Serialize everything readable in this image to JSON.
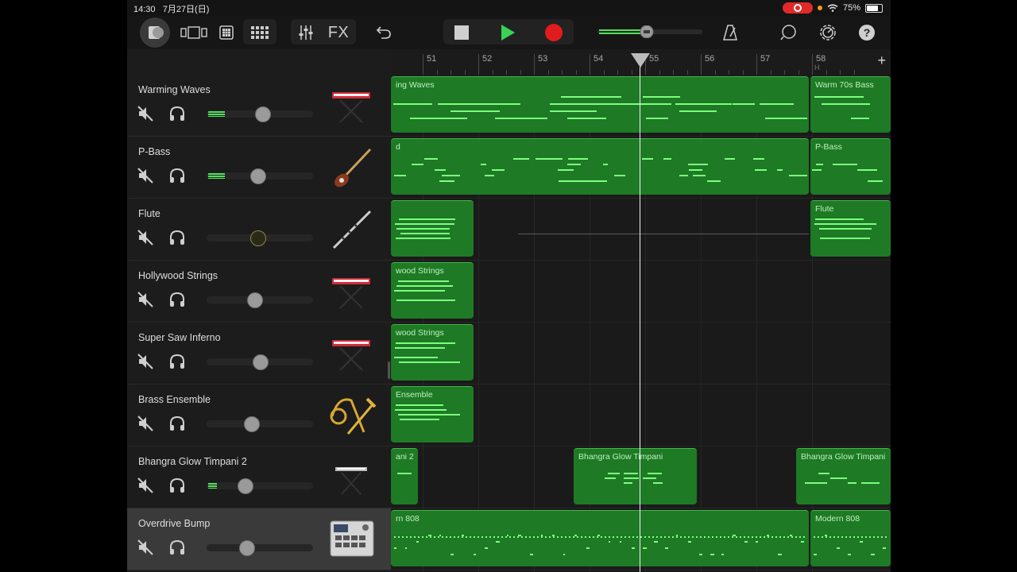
{
  "status": {
    "time": "14:30",
    "date": "7月27日(日)",
    "battery": "75%"
  },
  "toolbar": {
    "fx_label": "FX"
  },
  "ruler": {
    "bars": [
      "51",
      "52",
      "53",
      "54",
      "55",
      "56",
      "57",
      "58"
    ],
    "marker": "H"
  },
  "colors": {
    "region": "#1e7a25",
    "note": "#7cff7e",
    "play": "#39d353",
    "record": "#e21c1c"
  },
  "tracks": [
    {
      "name": "Warming Waves",
      "instrument": "keyboard-icon",
      "level": 0.16,
      "knob": 0.52,
      "selected": false
    },
    {
      "name": "P-Bass",
      "instrument": "bass-guitar-icon",
      "level": 0.16,
      "knob": 0.48,
      "selected": false
    },
    {
      "name": "Flute",
      "instrument": "flute-icon",
      "level": 0,
      "knob": 0.48,
      "selected": false
    },
    {
      "name": "Hollywood Strings",
      "instrument": "keyboard-icon",
      "level": 0,
      "knob": 0.45,
      "selected": false
    },
    {
      "name": "Super Saw Inferno",
      "instrument": "keyboard-icon",
      "level": 0,
      "knob": 0.5,
      "selected": false
    },
    {
      "name": "Brass Ensemble",
      "instrument": "brass-icon",
      "level": 0,
      "knob": 0.42,
      "selected": false
    },
    {
      "name": "Bhangra Glow Timpani 2",
      "instrument": "keyboard-stand-icon",
      "level": 0.08,
      "knob": 0.36,
      "selected": false
    },
    {
      "name": "Overdrive Bump",
      "instrument": "drum-machine-icon",
      "level": 0,
      "knob": 0.37,
      "selected": true
    }
  ],
  "regions": {
    "r0": "ing Waves",
    "r1": "Warm 70s Bass",
    "r2": "d",
    "r3": "P-Bass",
    "r4": "",
    "r5": "Flute",
    "r6": "wood Strings",
    "r7": "wood Strings",
    "r8": " Ensemble",
    "r9": "ani 2",
    "r10": "Bhangra Glow Timpani",
    "r11": "Bhangra Glow Timpani",
    "r12": "rn 808",
    "r13": "Modern 808"
  }
}
